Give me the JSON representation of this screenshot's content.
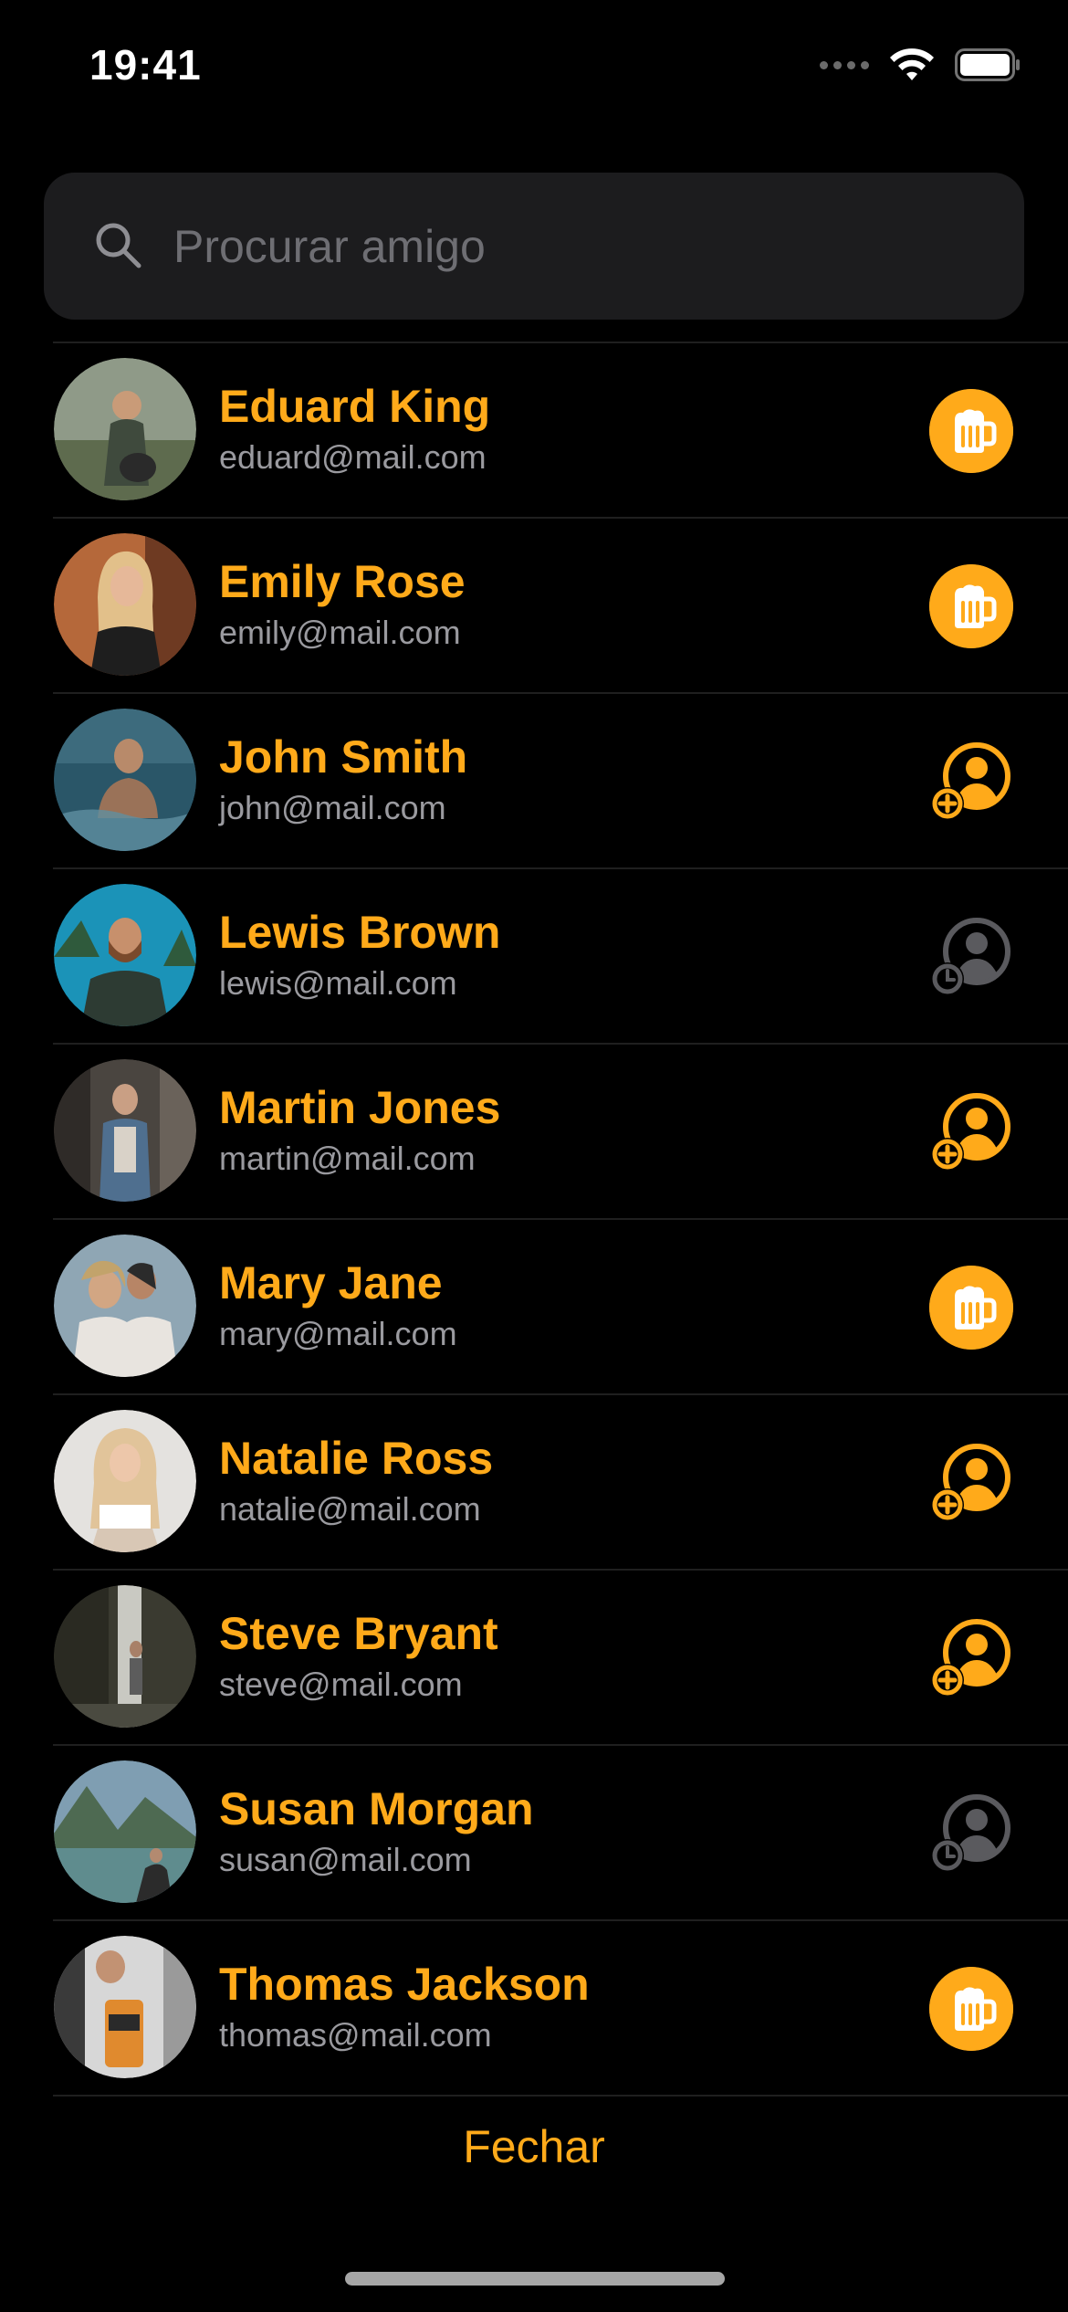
{
  "status_bar": {
    "time": "19:41"
  },
  "search": {
    "placeholder": "Procurar amigo",
    "value": ""
  },
  "colors": {
    "accent": "#ffaa1a",
    "background": "#000000",
    "search_bg": "#1c1c1e",
    "pending_icon": "#5a5a5e"
  },
  "friends": [
    {
      "name": "Eduard King",
      "email": "eduard@mail.com",
      "status": "friend",
      "action_icon": "beer-icon"
    },
    {
      "name": "Emily Rose",
      "email": "emily@mail.com",
      "status": "friend",
      "action_icon": "beer-icon"
    },
    {
      "name": "John Smith",
      "email": "john@mail.com",
      "status": "add",
      "action_icon": "add-friend-icon"
    },
    {
      "name": "Lewis Brown",
      "email": "lewis@mail.com",
      "status": "pending",
      "action_icon": "pending-friend-icon"
    },
    {
      "name": "Martin Jones",
      "email": "martin@mail.com",
      "status": "add",
      "action_icon": "add-friend-icon"
    },
    {
      "name": "Mary Jane",
      "email": "mary@mail.com",
      "status": "friend",
      "action_icon": "beer-icon"
    },
    {
      "name": "Natalie Ross",
      "email": "natalie@mail.com",
      "status": "add",
      "action_icon": "add-friend-icon"
    },
    {
      "name": "Steve Bryant",
      "email": "steve@mail.com",
      "status": "add",
      "action_icon": "add-friend-icon"
    },
    {
      "name": "Susan Morgan",
      "email": "susan@mail.com",
      "status": "pending",
      "action_icon": "pending-friend-icon"
    },
    {
      "name": "Thomas Jackson",
      "email": "thomas@mail.com",
      "status": "friend",
      "action_icon": "beer-icon"
    }
  ],
  "footer": {
    "close_label": "Fechar"
  }
}
